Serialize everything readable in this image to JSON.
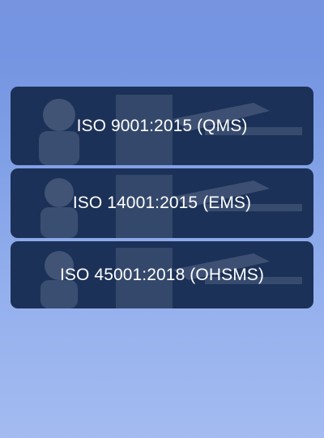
{
  "certifications": [
    {
      "label": "ISO 9001:2015 (QMS)"
    },
    {
      "label": "ISO 14001:2015 (EMS)"
    },
    {
      "label": "ISO 45001:2018 (OHSMS)"
    }
  ],
  "colors": {
    "background_top": "#6f8fdf",
    "background_bottom": "#a3bbf0",
    "card": "#1c3157",
    "label_text": "#ffffff"
  }
}
